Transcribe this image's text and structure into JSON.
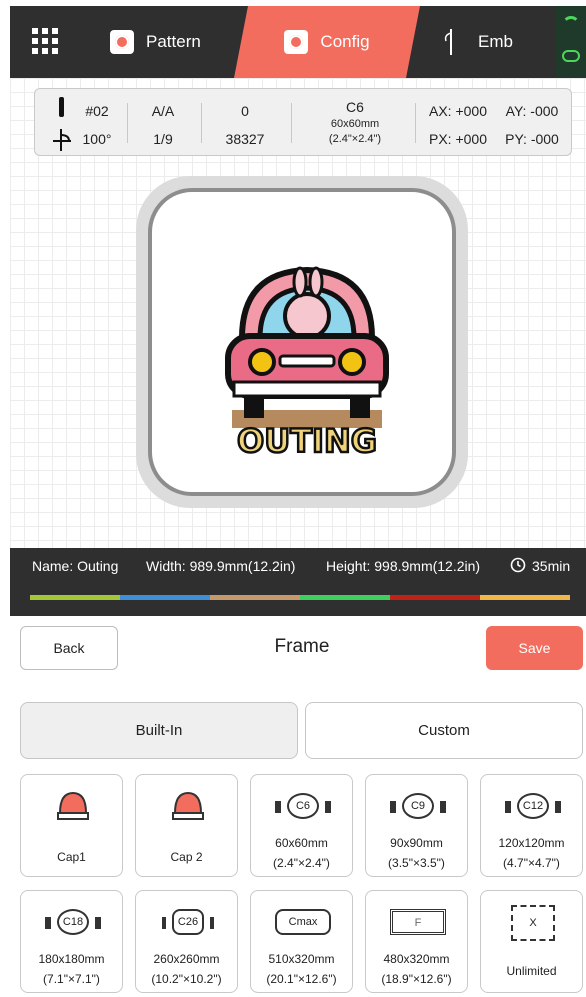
{
  "nav": {
    "tabs": [
      {
        "label": "Pattern",
        "icon": "flower-icon"
      },
      {
        "label": "Config",
        "icon": "config-edit-icon"
      },
      {
        "label": "Emb",
        "icon": "needle-icon"
      }
    ],
    "active_tab": "Config",
    "accent": "#f36d5f"
  },
  "stats": {
    "needle": "#02",
    "angle": "100°",
    "col2_top": "A/A",
    "col2_bottom": "1/9",
    "col3_top": "0",
    "col3_bottom": "38327",
    "hoop_name": "C6",
    "hoop_size": "60x60mm",
    "hoop_inch": "(2.4\"×2.4\")",
    "ax": "AX: +000",
    "ay": "AY: -000",
    "px": "PX: +000",
    "py": "PY: -000"
  },
  "design": {
    "text": "OUTING"
  },
  "info": {
    "name": "Name: Outing",
    "width": "Width: 989.9mm(12.2in)",
    "height": "Height: 998.9mm(12.2in)",
    "time": "35min",
    "colors": [
      "#a4c639",
      "#3f8fd8",
      "#c49a6c",
      "#3ecf5e",
      "#c0221a",
      "#f0b64a"
    ]
  },
  "panel": {
    "back": "Back",
    "title": "Frame",
    "save": "Save",
    "builtin": "Built-In",
    "custom": "Custom"
  },
  "frames": [
    {
      "name": "Cap1",
      "size": "",
      "inch": "",
      "type": "cap"
    },
    {
      "name": "Cap 2",
      "size": "",
      "inch": "",
      "type": "cap"
    },
    {
      "name": "C6",
      "size": "60x60mm",
      "inch": "(2.4\"×2.4\")",
      "type": "round"
    },
    {
      "name": "C9",
      "size": "90x90mm",
      "inch": "(3.5\"×3.5\")",
      "type": "round"
    },
    {
      "name": "C12",
      "size": "120x120mm",
      "inch": "(4.7\"×4.7\")",
      "type": "round"
    },
    {
      "name": "C18",
      "size": "180x180mm",
      "inch": "(7.1\"×7.1\")",
      "type": "round"
    },
    {
      "name": "C26",
      "size": "260x260mm",
      "inch": "(10.2\"×10.2\")",
      "type": "square"
    },
    {
      "name": "Cmax",
      "size": "510x320mm",
      "inch": "(20.1\"×12.6\")",
      "type": "rect"
    },
    {
      "name": "F",
      "size": "480x320mm",
      "inch": "(18.9\"×12.6\")",
      "type": "flat"
    },
    {
      "name": "X",
      "size": "Unlimited",
      "inch": "",
      "type": "dashed"
    }
  ]
}
